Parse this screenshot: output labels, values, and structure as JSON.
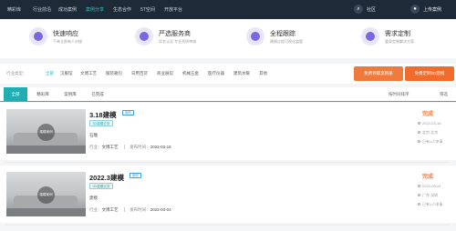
{
  "nav": {
    "items": [
      "精彩库",
      "行业前沿",
      "成功案例",
      "案例分享",
      "生态合作",
      "5T空间",
      "开放平台"
    ],
    "right_icon": "search-icon",
    "right_label_1": "社区",
    "right_label_2": "上传案例"
  },
  "features": [
    {
      "title": "快速响应",
      "subtitle": "下单立即有人对接",
      "icon": "bolt-icon"
    },
    {
      "title": "严选服务商",
      "subtitle": "实名认证 专业资质审核",
      "icon": "shield-icon"
    },
    {
      "title": "全程跟踪",
      "subtitle": "建模过程可视化监管",
      "icon": "track-icon"
    },
    {
      "title": "需求定制",
      "subtitle": "量身定制解决方案",
      "icon": "custom-icon"
    }
  ],
  "filter": {
    "label": "行业类型：",
    "options": [
      "全部",
      "汉服馆",
      "文博工艺",
      "服装箱包",
      "日用百货",
      "商业展馆",
      "机械五金",
      "医疗仪器",
      "建筑水暖",
      "其他"
    ],
    "cta_1": "免费领取案例册",
    "cta_2": "免费定制3D建模"
  },
  "tabs": {
    "items": [
      "全部",
      "精彩库",
      "案例库",
      "已完成"
    ],
    "sort_label": "按时间排序",
    "filter_label": "筛选"
  },
  "cards": [
    {
      "title": "3.18建模",
      "badge": "案例",
      "tag": "3D建模业务",
      "desc": "石雕",
      "industry_label": "行业：",
      "industry": "文博工艺",
      "date_label": "发布时间：",
      "date": "2022-03-16",
      "status": "完成",
      "thumb_watermark": "建模案例",
      "side": [
        "2022-03-16",
        "北京 北京",
        "已有1人申请"
      ]
    },
    {
      "title": "2022.3建模",
      "badge": "案例",
      "tag": "3D建模业务",
      "desc": "建模",
      "industry_label": "行业：",
      "industry": "文博工艺",
      "date_label": "发布时间：",
      "date": "2022-03-04",
      "status": "完成",
      "thumb_watermark": "建模案例",
      "side": [
        "2022-03-04",
        "广东 深圳",
        "已有1人申请"
      ]
    }
  ],
  "colors": {
    "nav_bg": "#1f2a38",
    "accent_teal": "#20aeb3",
    "accent_orange": "#f07a3c",
    "feature_icon": "#7a68e0"
  }
}
